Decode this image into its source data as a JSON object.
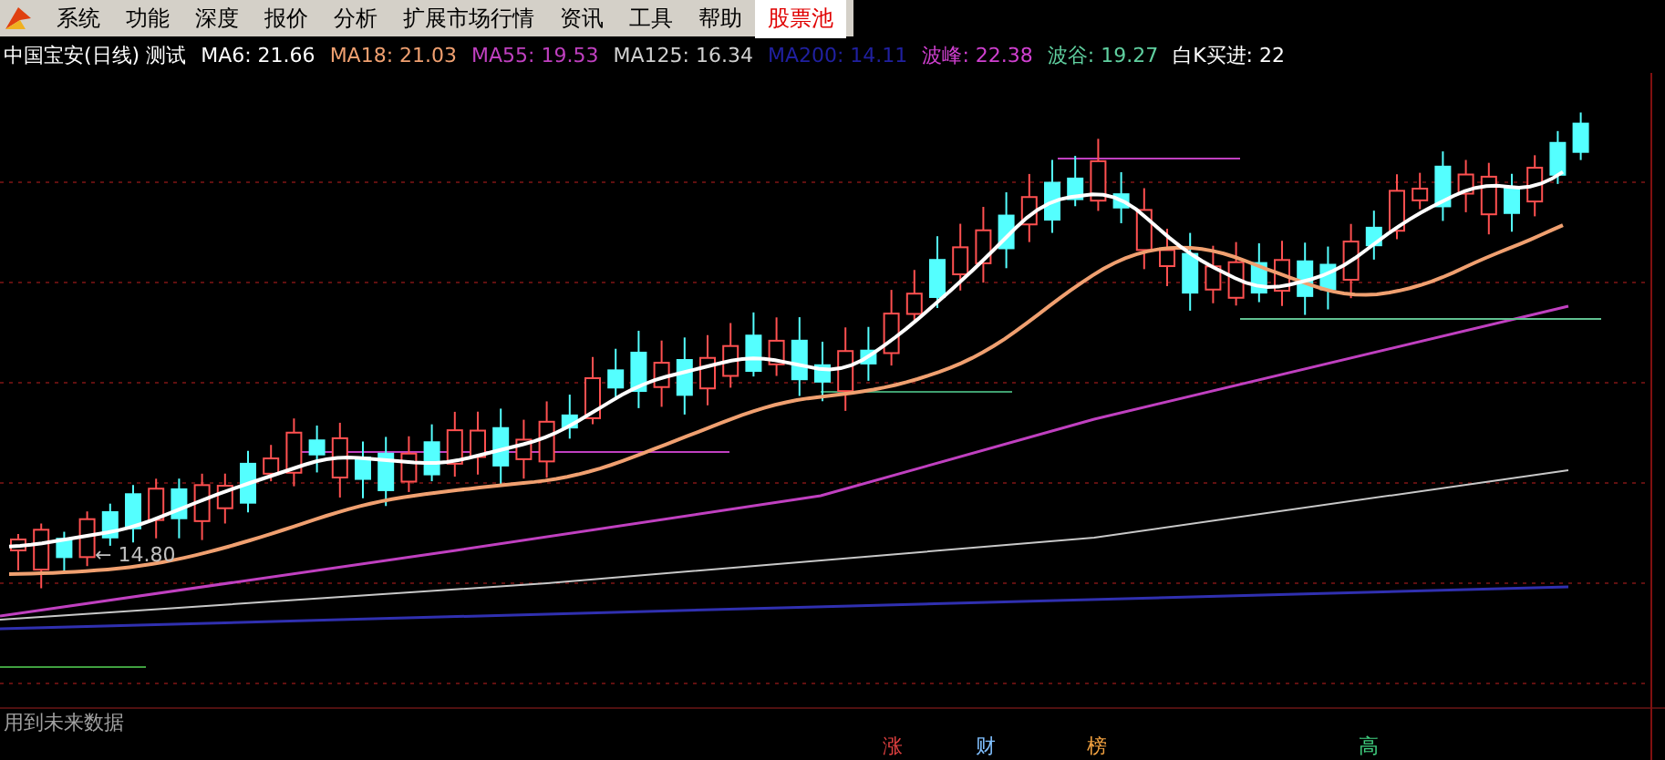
{
  "menu": {
    "items": [
      {
        "label": "系统",
        "selected": false
      },
      {
        "label": "功能",
        "selected": false
      },
      {
        "label": "深度",
        "selected": false
      },
      {
        "label": "报价",
        "selected": false
      },
      {
        "label": "分析",
        "selected": false
      },
      {
        "label": "扩展市场行情",
        "selected": false
      },
      {
        "label": "资讯",
        "selected": false
      },
      {
        "label": "工具",
        "selected": false
      },
      {
        "label": "帮助",
        "selected": false
      },
      {
        "label": "股票池",
        "selected": true
      }
    ]
  },
  "indicators": [
    {
      "text": "中国宝安(日线) 测试",
      "color": "#ffffff"
    },
    {
      "text": "MA6: 21.66",
      "color": "#ffffff"
    },
    {
      "text": "MA18: 21.03",
      "color": "#f0a070"
    },
    {
      "text": "MA55: 19.53",
      "color": "#c040c0"
    },
    {
      "text": "MA125: 16.34",
      "color": "#d0d0d0"
    },
    {
      "text": "MA200: 14.11",
      "color": "#2020a0"
    },
    {
      "text": "波峰: 22.38",
      "color": "#d040d0"
    },
    {
      "text": "波谷: 19.27",
      "color": "#60d0a0"
    },
    {
      "text": "白K买进: 22",
      "color": "#ffffff"
    }
  ],
  "chart": {
    "price_label": "← 14.80"
  },
  "footer": {
    "note": "用到未来数据",
    "signals": [
      {
        "text": "涨",
        "color": "#e04040"
      },
      {
        "text": "财",
        "color": "#80c0ff"
      },
      {
        "text": "榜",
        "color": "#f0a040"
      },
      {
        "text": "高",
        "color": "#40d080"
      }
    ]
  }
}
